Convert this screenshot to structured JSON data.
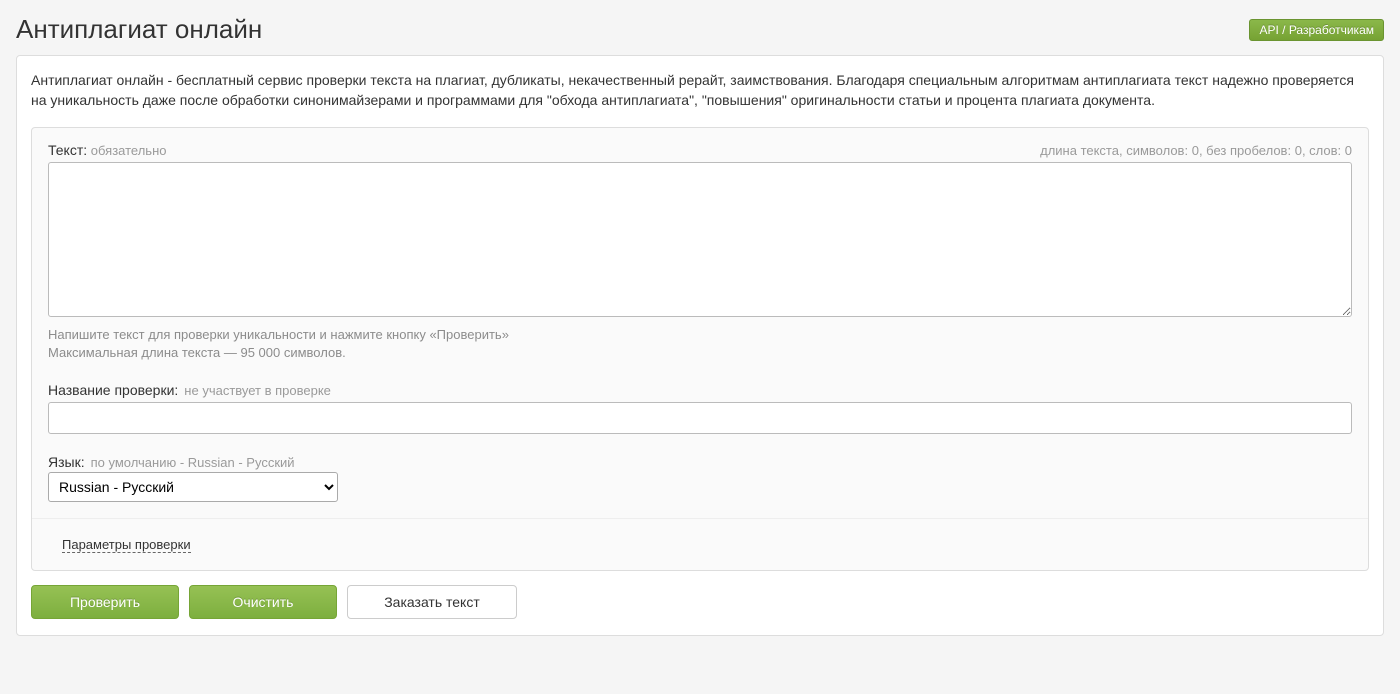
{
  "header": {
    "title": "Антиплагиат онлайн",
    "api_button": "API / Разработчикам"
  },
  "intro": "Антиплагиат онлайн - бесплатный сервис проверки текста на плагиат, дубликаты, некачественный рерайт, заимствования. Благодаря специальным алгоритмам антиплагиата текст надежно проверяется на уникальность даже после обработки синонимайзерами и программами для \"обхода антиплагиата\", \"повышения\" оригинальности статьи и процента плагиата документа.",
  "form": {
    "text": {
      "label": "Текст:",
      "hint": "обязательно",
      "stats_prefix_chars": "длина текста, символов:",
      "stats_chars": "0",
      "stats_prefix_nospace": ", без пробелов:",
      "stats_nospace": "0",
      "stats_prefix_words": ", слов:",
      "stats_words": "0",
      "value": "",
      "help1": "Напишите текст для проверки уникальности и нажмите кнопку «Проверить»",
      "help2": "Максимальная длина текста — 95 000 символов."
    },
    "title": {
      "label": "Название проверки:",
      "hint": "не участвует в проверке",
      "value": ""
    },
    "language": {
      "label": "Язык:",
      "hint": "по умолчанию - Russian - Русский",
      "selected": "Russian - Русский"
    },
    "params_link": "Параметры проверки"
  },
  "actions": {
    "check": "Проверить",
    "clear": "Очистить",
    "order": "Заказать текст"
  }
}
